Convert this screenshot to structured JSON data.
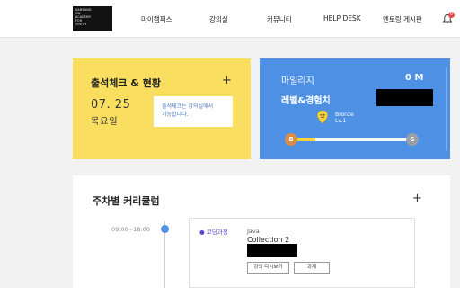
{
  "header": {
    "logo_lines": [
      "SAMSUNG",
      "SW",
      "ACADEMY",
      "FOR",
      "YOUTH"
    ],
    "nav": [
      "마이캠퍼스",
      "강의실",
      "커뮤니티",
      "HELP DESK",
      "멘토링 게시판"
    ],
    "notification_count": "0"
  },
  "attendance": {
    "title": "출석체크 & 현황",
    "date": "07. 25",
    "weekday": "목요일",
    "notice_line1": "출석체크는 강의실에서",
    "notice_line2": "가능합니다."
  },
  "mileage": {
    "title": "마일리지",
    "value": "0 M",
    "level_title": "레벨&경험치",
    "badge_name": "Bronze",
    "badge_level": "Lv.1",
    "start_mark": "B",
    "end_mark": "S",
    "progress": 0.2
  },
  "curriculum": {
    "title": "주차별 커리큘럼",
    "time": "09:00~18:00",
    "course_type": "코딩과정",
    "course_subject": "Java",
    "course_name": "Collection 2",
    "btn_review": "강의 다시보기",
    "btn_homework": "과제"
  },
  "colors": {
    "attendance_bg": "#f9de5f",
    "mileage_bg": "#4d90e4",
    "accent": "#4d90e4"
  }
}
